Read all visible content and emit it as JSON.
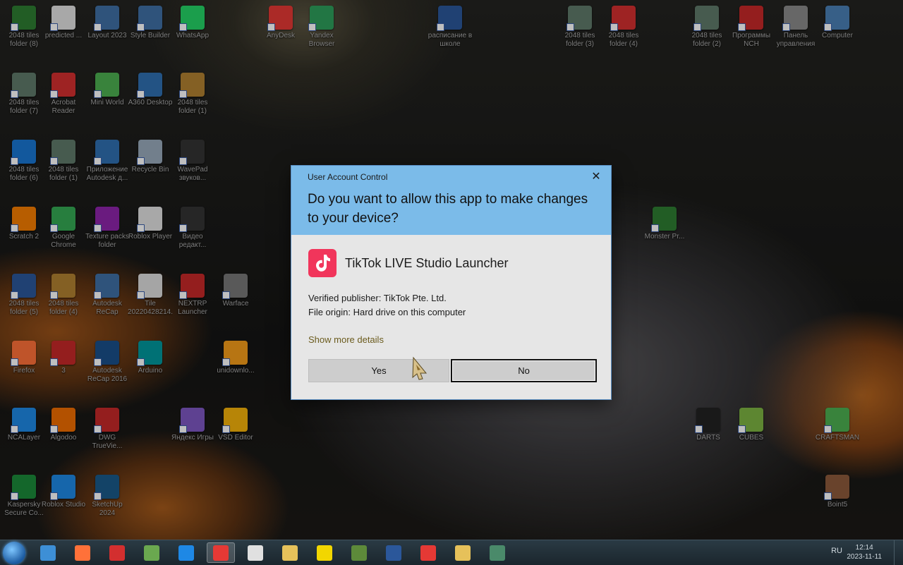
{
  "desktop": {
    "icons": [
      {
        "label": "2048 tiles folder (8)",
        "color": "#2e7d32"
      },
      {
        "label": "predicted ...",
        "color": "#e0e0e0"
      },
      {
        "label": "Layout 2023",
        "color": "#3f6fa5"
      },
      {
        "label": "Style Builder",
        "color": "#3f6fa5"
      },
      {
        "label": "WhatsApp",
        "color": "#25d366"
      },
      {
        "label": "AnyDesk",
        "color": "#e53935"
      },
      {
        "label": "Yandex Browser",
        "color": "#2e9e5b"
      },
      {
        "label": "расписание в школе",
        "color": "#2b579a"
      },
      {
        "label": "2048 tiles folder (3)",
        "color": "#5f7a6a"
      },
      {
        "label": "2048 tiles folder (4)",
        "color": "#d32f2f"
      },
      {
        "label": "2048 tiles folder (2)",
        "color": "#5f7a6a"
      },
      {
        "label": "Программы NCH",
        "color": "#c62828"
      },
      {
        "label": "Панель управления",
        "color": "#8a8a8a"
      },
      {
        "label": "Computer",
        "color": "#4a7fb5"
      },
      {
        "label": "2048 tiles folder (7)",
        "color": "#5f7a6a"
      },
      {
        "label": "Acrobat Reader",
        "color": "#d32f2f"
      },
      {
        "label": "Mini World",
        "color": "#4caf50"
      },
      {
        "label": "A360 Desktop",
        "color": "#2f6fb0"
      },
      {
        "label": "2048 tiles folder (1)",
        "color": "#b08030"
      },
      {
        "label": "2048 tiles folder (6)",
        "color": "#1976d2"
      },
      {
        "label": "2048 tiles folder (1)",
        "color": "#5f7a6a"
      },
      {
        "label": "Приложение Autodesk д...",
        "color": "#2f6fb0"
      },
      {
        "label": "Recycle Bin",
        "color": "#9ab"
      },
      {
        "label": "WavePad звуков...",
        "color": "#333"
      },
      {
        "label": "Scratch 2",
        "color": "#f57c00"
      },
      {
        "label": "Google Chrome",
        "color": "#34a853"
      },
      {
        "label": "Texture packs folder",
        "color": "#8e24aa"
      },
      {
        "label": "Roblox Player",
        "color": "#e0e0e0"
      },
      {
        "label": "Видео редакт...",
        "color": "#333"
      },
      {
        "label": "2048 tiles folder (5)",
        "color": "#2b579a"
      },
      {
        "label": "2048 tiles folder (4)",
        "color": "#b08030"
      },
      {
        "label": "Autodesk ReCap",
        "color": "#3f6fa5"
      },
      {
        "label": "Tile 20220428214...",
        "color": "#ddd"
      },
      {
        "label": "NEXTRP Launcher",
        "color": "#c62828"
      },
      {
        "label": "Warface",
        "color": "#777"
      },
      {
        "label": "Firefox",
        "color": "#ff7139"
      },
      {
        "label": "3",
        "color": "#c62828"
      },
      {
        "label": "Autodesk ReCap 2016",
        "color": "#1a4f8a"
      },
      {
        "label": "Arduino",
        "color": "#00979d"
      },
      {
        "label": "unidownlo...",
        "color": "#f59c1a"
      },
      {
        "label": "NCALayer",
        "color": "#1e88e5"
      },
      {
        "label": "Algodoo",
        "color": "#ef6c00"
      },
      {
        "label": "DWG TrueVie...",
        "color": "#c62828"
      },
      {
        "label": "Яндекс Игры",
        "color": "#7e57c2"
      },
      {
        "label": "VSD Editor",
        "color": "#f5b20a"
      },
      {
        "label": "Kaspersky Secure Co...",
        "color": "#1b8a3a"
      },
      {
        "label": "Roblox Studio",
        "color": "#1e88e5"
      },
      {
        "label": "SketchUp 2024",
        "color": "#1a5a8a"
      },
      {
        "label": "DARTS",
        "color": "#222"
      },
      {
        "label": "CUBES",
        "color": "#7cb342"
      },
      {
        "label": "CRAFTSMAN",
        "color": "#4caf50"
      },
      {
        "label": "Boint5",
        "color": "#8d5a3b"
      },
      {
        "label": "Monster Pr...",
        "color": "#2e7d32"
      }
    ]
  },
  "uac": {
    "title": "User Account Control",
    "close": "✕",
    "question": "Do you want to allow this app to make changes to your device?",
    "app_name": "TikTok LIVE Studio Launcher",
    "publisher": "Verified publisher: TikTok Pte. Ltd.",
    "origin": "File origin: Hard drive on this computer",
    "show_more": "Show more details",
    "yes_label": "Yes",
    "no_label": "No"
  },
  "taskbar": {
    "pinned": [
      {
        "name": "explorer-icon",
        "color": "#3d8fd6"
      },
      {
        "name": "firefox-icon",
        "color": "#ff7139"
      },
      {
        "name": "acrobat-icon",
        "color": "#d32f2f"
      },
      {
        "name": "minecraft-icon",
        "color": "#6aa84f"
      },
      {
        "name": "ie-icon",
        "color": "#1e88e5"
      },
      {
        "name": "yandex-browser-icon",
        "color": "#e53935"
      },
      {
        "name": "app-icon",
        "color": "#e0e0e0"
      },
      {
        "name": "folder-icon",
        "color": "#e6c15a"
      },
      {
        "name": "yandex-music-icon",
        "color": "#f2d600"
      },
      {
        "name": "minecraft-launcher-icon",
        "color": "#5d8a3a"
      },
      {
        "name": "word-icon",
        "color": "#2b579a"
      },
      {
        "name": "yandex-icon",
        "color": "#e53935"
      },
      {
        "name": "files-icon",
        "color": "#e6c15a"
      },
      {
        "name": "window-icon",
        "color": "#4a8a6a"
      }
    ],
    "active_index": 5,
    "language": "RU",
    "time": "12:14",
    "date": "2023-11-11"
  }
}
